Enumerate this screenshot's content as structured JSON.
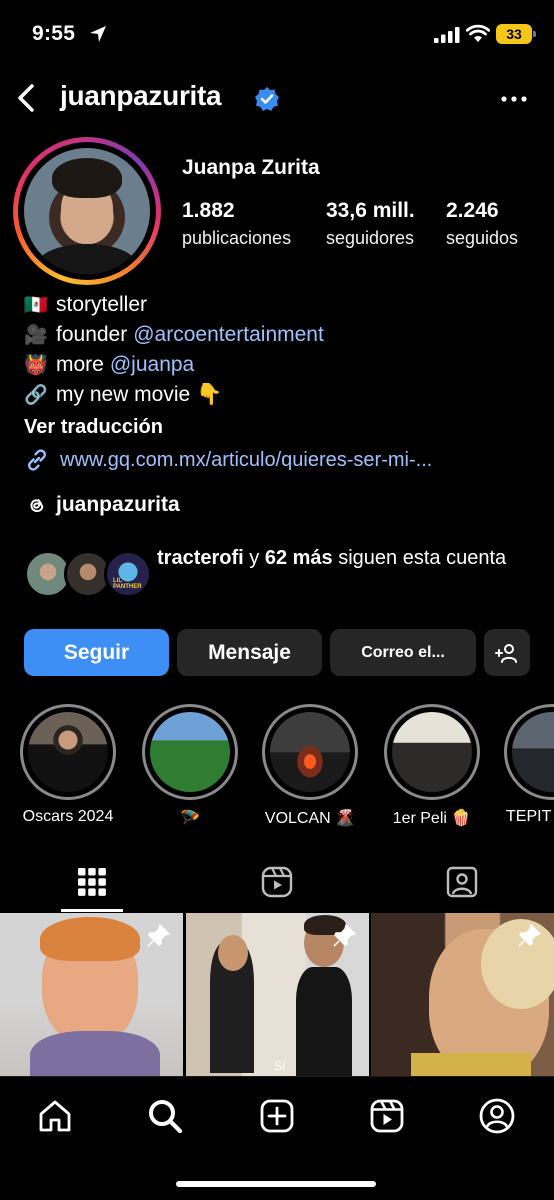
{
  "status_bar": {
    "time": "9:55",
    "battery": "33"
  },
  "header": {
    "username": "juanpazurita"
  },
  "profile": {
    "full_name": "Juanpa Zurita",
    "stats": [
      {
        "value": "1.882",
        "label": "publicaciones"
      },
      {
        "value": "33,6 mill.",
        "label": "seguidores"
      },
      {
        "value": "2.246",
        "label": "seguidos"
      }
    ]
  },
  "bio": {
    "lines": [
      {
        "emoji": "🇲🇽",
        "text": "storyteller",
        "mention": ""
      },
      {
        "emoji": "🎥",
        "text": "founder",
        "mention": "@arcoentertainment"
      },
      {
        "emoji": "👹",
        "text": "more",
        "mention": "@juanpa"
      },
      {
        "emoji": "🔗",
        "text": "my new movie 👇",
        "mention": ""
      }
    ],
    "translate_label": "Ver traducción",
    "link": "www.gq.com.mx/articulo/quieres-ser-mi-..."
  },
  "threads": {
    "label": "juanpazurita"
  },
  "followed_by": {
    "name": "tracterofi",
    "connector": " y ",
    "count": "62 más",
    "suffix": " siguen esta cuenta",
    "avatar_tag": "LIL PANTHER"
  },
  "buttons": {
    "follow": "Seguir",
    "message": "Mensaje",
    "email": "Correo el..."
  },
  "highlights": [
    {
      "label": "Oscars 2024"
    },
    {
      "label": "🪂"
    },
    {
      "label": "VOLCAN 🌋"
    },
    {
      "label": "1er Peli 🍿"
    },
    {
      "label": "TEPIT"
    }
  ],
  "tabs": [
    {
      "name": "posts",
      "icon": "grid-icon",
      "active": true
    },
    {
      "name": "reels",
      "icon": "reels-icon",
      "active": false
    },
    {
      "name": "tagged",
      "icon": "tagged-icon",
      "active": false
    }
  ],
  "grid": [
    {
      "pinned": true,
      "caption": ""
    },
    {
      "pinned": true,
      "caption": "Sí"
    },
    {
      "pinned": true,
      "caption": ""
    }
  ],
  "bottom_nav": [
    {
      "name": "home",
      "icon": "home-icon"
    },
    {
      "name": "search",
      "icon": "search-icon"
    },
    {
      "name": "create",
      "icon": "plus-square-icon"
    },
    {
      "name": "reels",
      "icon": "reels-icon"
    },
    {
      "name": "profile",
      "icon": "profile-icon"
    }
  ],
  "colors": {
    "accent": "#3e8ff5",
    "link": "#9ec2ff",
    "button_dark": "#262626",
    "battery": "#f5c518"
  }
}
